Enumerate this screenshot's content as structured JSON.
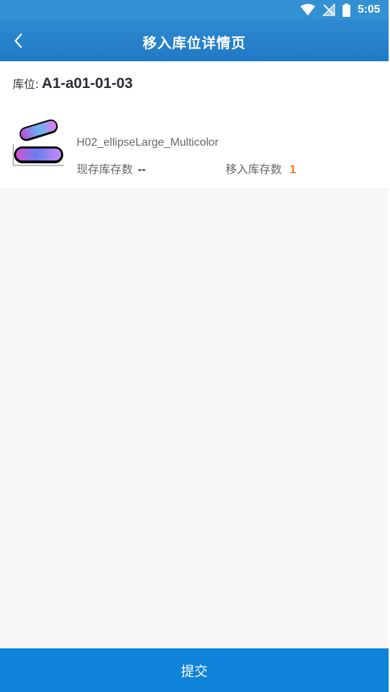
{
  "status_bar": {
    "time": "5:05",
    "icons": [
      "wifi-icon",
      "no-signal-icon",
      "battery-icon"
    ]
  },
  "header": {
    "title": "移入库位详情页",
    "back_icon": "chevron-left-icon"
  },
  "location": {
    "label": "库位:",
    "value": "A1-a01-01-03"
  },
  "product": {
    "name": "H02_ellipseLarge_Multicolor",
    "current_stock_label": "现存库存数",
    "current_stock_value": "--",
    "move_qty_label": "移入库存数",
    "move_qty_value": "1"
  },
  "footer": {
    "submit_label": "提交"
  },
  "colors": {
    "header": "#2079c6",
    "status_bar": "#3390d3",
    "submit": "#0f82d9",
    "accent_qty": "#f07b2a",
    "background": "#f8f8f8"
  }
}
